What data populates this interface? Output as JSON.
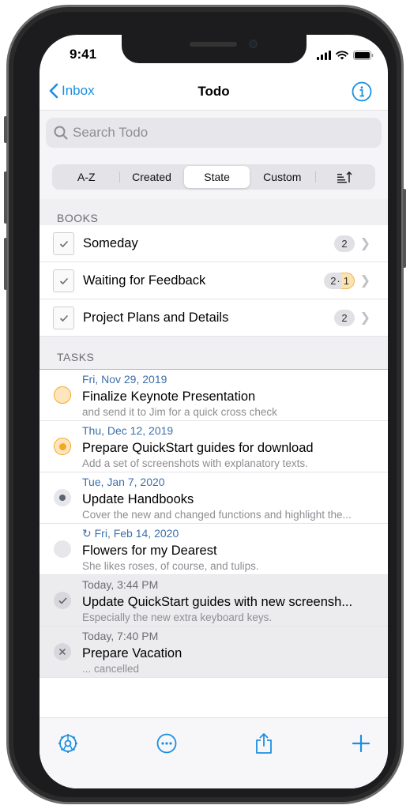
{
  "status": {
    "time": "9:41"
  },
  "nav": {
    "back_label": "Inbox",
    "title": "Todo"
  },
  "search": {
    "placeholder": "Search Todo"
  },
  "sort": {
    "options": [
      "A-Z",
      "Created",
      "State",
      "Custom"
    ],
    "selected": "State"
  },
  "books": {
    "header": "BOOKS",
    "items": [
      {
        "title": "Someday",
        "badge": "2"
      },
      {
        "title": "Waiting for Feedback",
        "badge": "2",
        "badge_extra": "1"
      },
      {
        "title": "Project Plans and Details",
        "badge": "2"
      }
    ]
  },
  "tasks": {
    "header": "TASKS",
    "items": [
      {
        "date": "Fri, Nov 29, 2019",
        "title": "Finalize Keynote Presentation",
        "note": "and send it to Jim for a quick cross check",
        "state": "open-orange"
      },
      {
        "date": "Thu, Dec 12, 2019",
        "title": "Prepare QuickStart guides for download",
        "note": "Add a set of screenshots with explanatory texts.",
        "state": "in-progress"
      },
      {
        "date": "Tue, Jan 7, 2020",
        "title": "Update Handbooks",
        "note": "Cover the new and changed functions and highlight the...",
        "state": "dot-gray"
      },
      {
        "date": "↻ Fri, Feb 14, 2020",
        "title": "Flowers for my Dearest",
        "note": "She likes roses, of course, and tulips.",
        "state": "open-gray"
      },
      {
        "date": "Today, 3:44 PM",
        "title": "Update QuickStart guides with new screensh...",
        "note": "Especially the new extra keyboard keys.",
        "state": "done"
      },
      {
        "date": "Today, 7:40 PM",
        "title": "Prepare Vacation",
        "note": "... cancelled",
        "state": "cancelled"
      }
    ]
  },
  "toolbar": {
    "icons": [
      "settings-icon",
      "more-icon",
      "share-icon",
      "add-icon"
    ]
  },
  "colors": {
    "accent": "#1a8fe0",
    "orange": "#f5a623",
    "date_blue": "#3d6fa8"
  }
}
